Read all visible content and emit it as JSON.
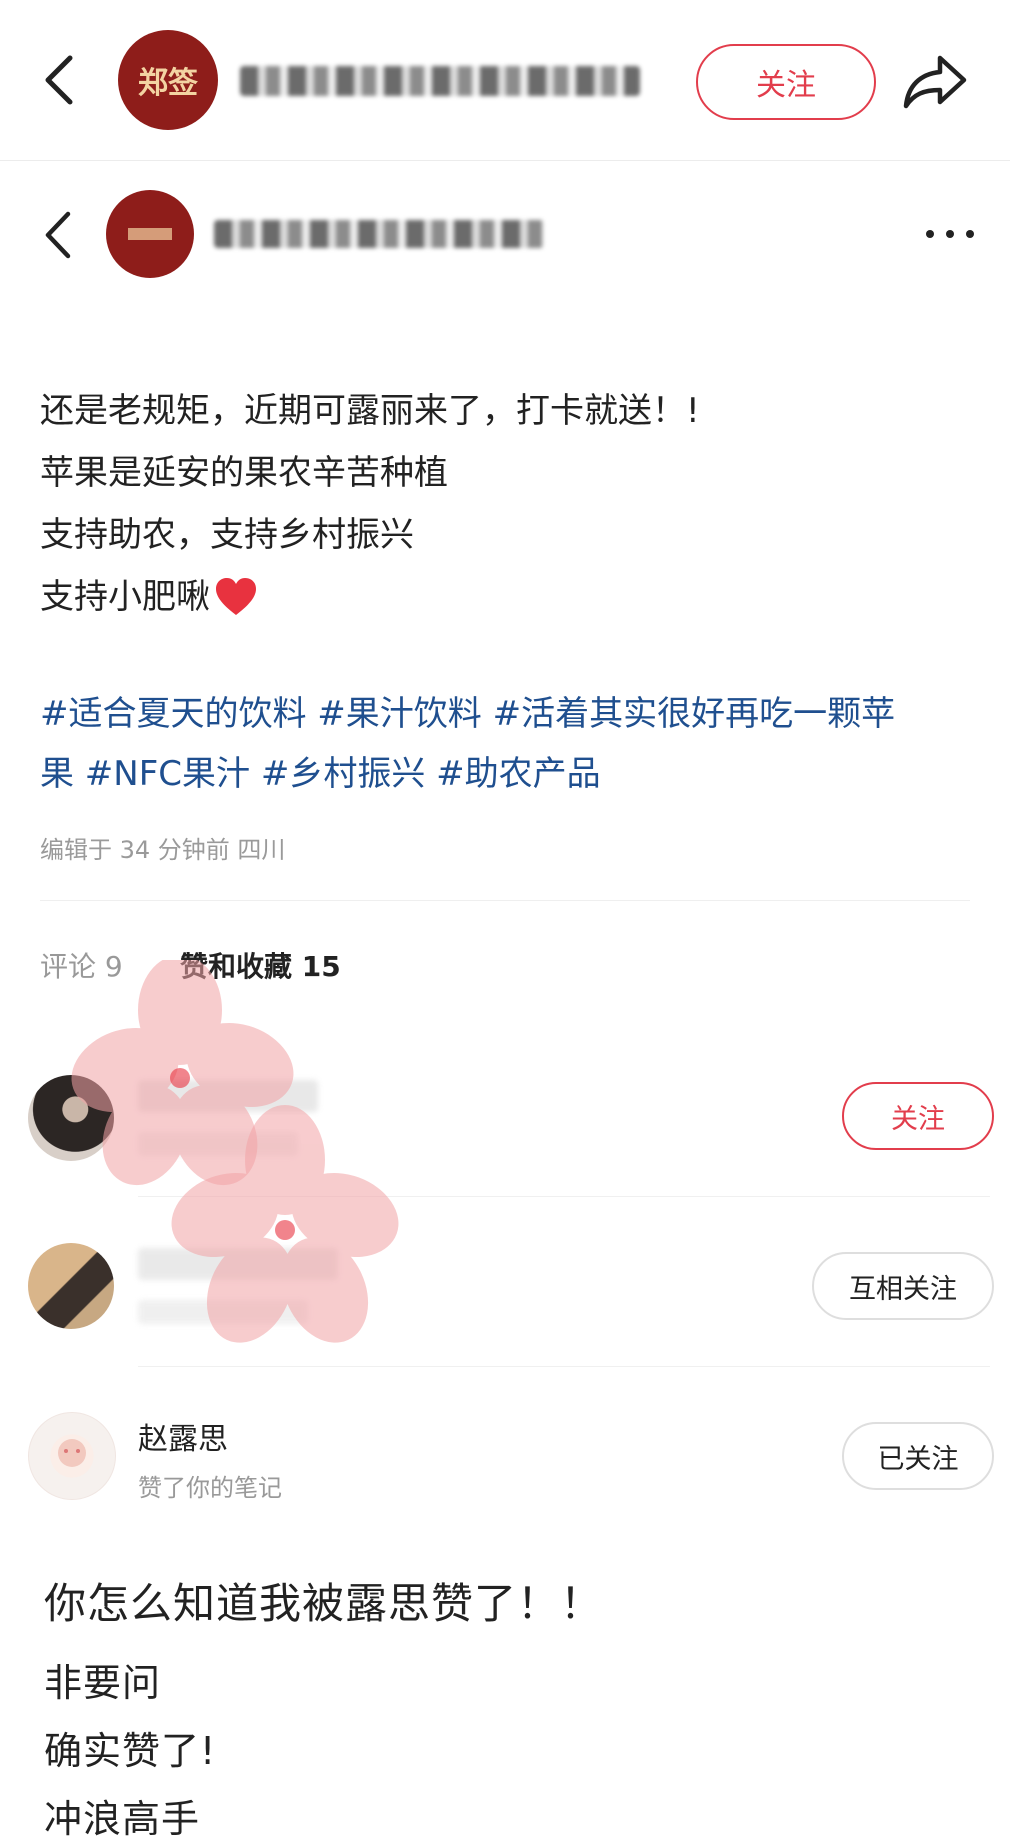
{
  "top_bar": {
    "brand_logo_text": "郑签",
    "follow_label": "关注"
  },
  "post": {
    "lines": [
      "还是老规矩，近期可露丽来了，打卡就送！!",
      "苹果是延安的果农辛苦种植",
      "支持助农，支持乡村振兴",
      "支持小肥啾"
    ],
    "tags_line1": "#适合夏天的饮料 #果汁饮料 #活着其实很好再吃一颗苹",
    "tags_line2": "果 #NFC果汁 #乡村振兴 #助农产品",
    "edited_meta": "编辑于 34 分钟前 四川"
  },
  "tabs": {
    "comments": "评论 9",
    "likes": "赞和收藏 15"
  },
  "users": [
    {
      "name": "",
      "action": "",
      "button": "关注"
    },
    {
      "name": "",
      "action": "",
      "button": "互相关注"
    },
    {
      "name": "赵露思",
      "action": "赞了你的笔记",
      "button": "已关注"
    }
  ],
  "caption": {
    "question": "你怎么知道我被露思赞了！！",
    "answers": [
      "非要问",
      "确实赞了!",
      "冲浪高手"
    ]
  },
  "colors": {
    "accent_red": "#e23d4c",
    "tag_blue": "#1f4f8f",
    "heart": "#e8323f"
  }
}
